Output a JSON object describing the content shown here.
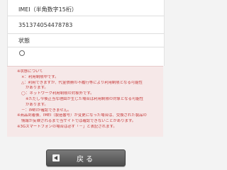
{
  "form": {
    "imei_label": "IMEI（半角数字15桁）",
    "imei_value": "351374054478783",
    "status_label": "状態"
  },
  "notice": {
    "lines": [
      "※状態について",
      "×：利用制限中です。",
      "△：利用できますが、代金債務の不履行等により利用制限となる可能性",
      "があります。",
      "◯：ネットワーク利用制限の対象外です。",
      "※ただし今後正当な理由が生じた場合は利用制限の対象となる可能性",
      "があります。",
      "－：IMEIが確認できません。",
      "※商品到着後、IMEI（製造番号）が変更になった場合は、交換された製品の",
      "情報が反映されるまで当サイトでは確認できないことがあります。",
      "※3Gスマートフォンの場合は必ず「－」と表記されます。"
    ]
  },
  "footer": {
    "back_label": "戻る"
  }
}
